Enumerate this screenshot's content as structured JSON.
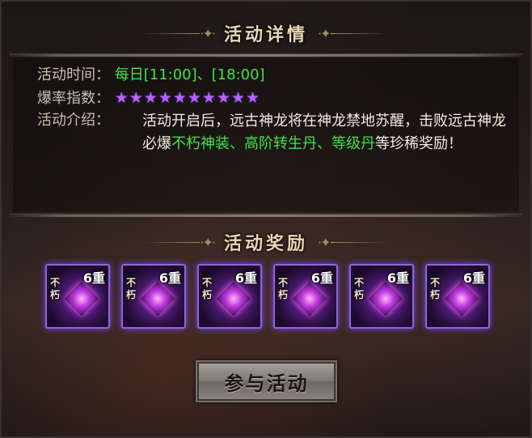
{
  "details": {
    "title": "活动详情",
    "time_label": "活动时间：",
    "time_value": "每日[11:00]、[18:00]",
    "rate_label": "爆率指数：",
    "rate_stars": "★★★★★★★★★★",
    "intro_label": "活动介绍：",
    "intro_text_1": "活动开启后，远古神龙将在神龙禁地苏醒，击败远古神龙必爆",
    "intro_highlight": "不朽神装、高阶转生丹、等级丹",
    "intro_text_2": "等珍稀奖励！"
  },
  "rewards": {
    "title": "活动奖励",
    "items": [
      {
        "tag": "不朽",
        "rank": "6重",
        "icon": "purple-armor-icon"
      },
      {
        "tag": "不朽",
        "rank": "6重",
        "icon": "purple-armor-icon"
      },
      {
        "tag": "不朽",
        "rank": "6重",
        "icon": "purple-gem-icon"
      },
      {
        "tag": "不朽",
        "rank": "6重",
        "icon": "purple-shield-icon"
      },
      {
        "tag": "不朽",
        "rank": "6重",
        "icon": "purple-flame-icon"
      },
      {
        "tag": "不朽",
        "rank": "6重",
        "icon": "purple-helmet-icon"
      }
    ]
  },
  "join_button": "参与活动",
  "colors": {
    "highlight_green": "#43e24a",
    "star_purple": "#b266ff",
    "title_gold": "#e8d6b6"
  }
}
